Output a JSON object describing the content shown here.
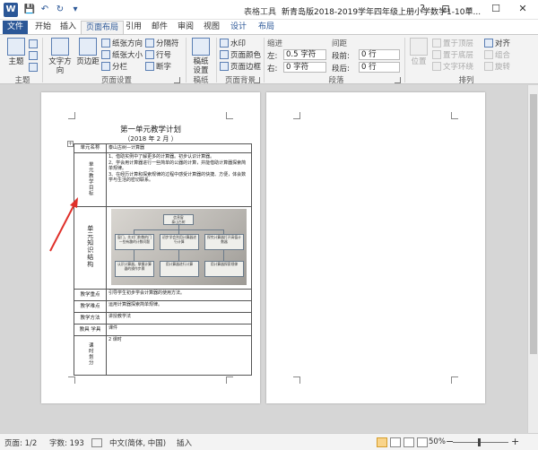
{
  "window": {
    "app_icon": "W",
    "tool_context": "表格工具",
    "document_title": "新青岛版2018-2019学年四年级上册小学数学1-10单...",
    "controls": {
      "options": "?",
      "restore": "⊡",
      "minimize": "─",
      "maximize": "☐",
      "close": "✕"
    }
  },
  "quick_access": {
    "save": "💾",
    "undo": "↶",
    "redo": "↻",
    "customize": "▾"
  },
  "tabs": [
    "开始",
    "插入",
    "页面布局",
    "引用",
    "邮件",
    "审阅",
    "视图",
    "设计",
    "布局"
  ],
  "file_tab": "文件",
  "active_tab": "页面布局",
  "ribbon": {
    "themes": {
      "label": "主题",
      "btn_theme": "主题"
    },
    "page_setup": {
      "label": "页面设置",
      "text_direction": "文字方向",
      "margins": "页边距",
      "orientation": "纸张方向",
      "size": "纸张大小",
      "columns": "分栏",
      "breaks": "分隔符",
      "line_numbers": "行号",
      "hyphenation": "断字"
    },
    "draft": {
      "label": "稿纸",
      "btn": "稿纸\n设置"
    },
    "page_background": {
      "label": "页面背景",
      "watermark": "水印",
      "page_color": "页面颜色",
      "page_borders": "页面边框"
    },
    "paragraph": {
      "label": "段落",
      "indent_title": "缩进",
      "spacing_title": "间距",
      "indent_left_label": "左:",
      "indent_left_value": "0.5 字符",
      "indent_right_label": "右:",
      "indent_right_value": "0 字符",
      "space_before_label": "段前:",
      "space_before_value": "0 行",
      "space_after_label": "段后:",
      "space_after_value": "0 行"
    },
    "arrange": {
      "label": "排列",
      "position": "位置",
      "bring_forward": "置于顶层",
      "send_backward": "置于底层",
      "wrap_text": "文字环绕",
      "align": "对齐",
      "group": "组合",
      "rotate": "旋转"
    }
  },
  "document": {
    "title": "第一单元教学计划",
    "date": "（2018 年 2 月 ）",
    "table": {
      "unit_name_label": "单元名称",
      "unit_name_value": "泰山古树—计算器",
      "objectives_label": "单元教学目标",
      "objectives": [
        "1、借助实例中了解更多的计算器。初步认识计算器。",
        "2、学会用计算器进行一些简单的公器的计算，并能借助计算器探索简单规律。",
        "3、在经历计算和探索规律的过程中感受计算器的快捷、方便，体会数学与生活的密切联系。"
      ],
      "structure_label": "单元知识结构",
      "diagram": {
        "root_lines": [
          "信息窗",
          "泰山古树"
        ],
        "mid": [
          "窗门，先对门和数的门一些有趣的计数问题",
          "初步学会利用计算器进行计算",
          "探究计算器打开高值计数器"
        ],
        "bottom": [
          "认识计算器，掌握计算器的操作步骤",
          "用计算器进行计算",
          "用计算器探索规律"
        ]
      },
      "rows": [
        {
          "label": "教学重点",
          "value": "引导学生初步学会计算器的使用方法。"
        },
        {
          "label": "教学难点",
          "value": "运用计算器探索简单规律。"
        },
        {
          "label": "教学方法",
          "value": "讲授教学法"
        },
        {
          "label": "教具 学具",
          "value": "课件"
        }
      ],
      "hours_label": "课时划分",
      "hours_value": "2 课时"
    }
  },
  "status": {
    "page": "页面: 1/2",
    "words": "字数: 193",
    "language": "中文(简体, 中国)",
    "mode": "插入",
    "zoom": "50%",
    "zoom_out": "−",
    "zoom_in": "+"
  }
}
